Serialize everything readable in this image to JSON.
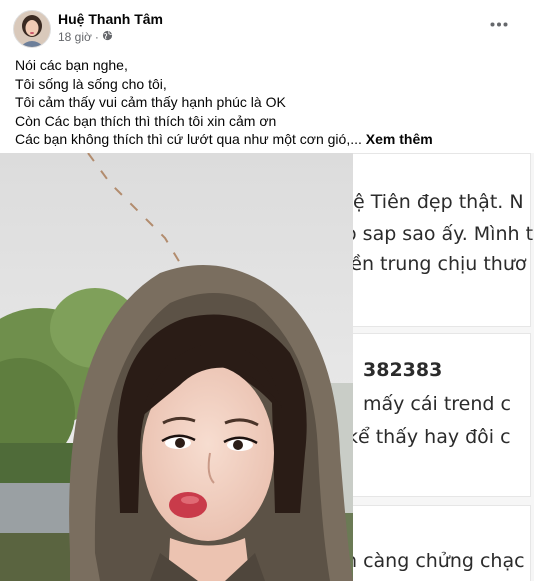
{
  "post": {
    "author": "Huệ Thanh Tâm",
    "time": "18 giờ",
    "time_separator": "·",
    "audience_icon": "globe-icon",
    "more_icon": "more-options-icon",
    "lines": [
      "Nói các bạn nghe,",
      "Tôi sống là sống cho tôi,",
      "Tôi cảm thấy vui cảm thấy hạnh phúc là OK",
      "Còn Các bạn thích thì thích tôi xin cảm ơn",
      "Các bạn không thích thì cứ lướt qua như một cơn gió,..."
    ],
    "see_more": "Xem thêm"
  },
  "overlay": {
    "lines": [
      "hệ Tiên đẹp thật. N",
      "o sap sao ấy. Mình t",
      "iền trung chịu thươ",
      "382383",
      "mấy cái trend c",
      "kể thấy hay đôi c",
      "n càng chửng chạc"
    ]
  },
  "colors": {
    "text": "#050505",
    "secondary": "#65676b",
    "overlay_bg": "#f6f6f6"
  }
}
